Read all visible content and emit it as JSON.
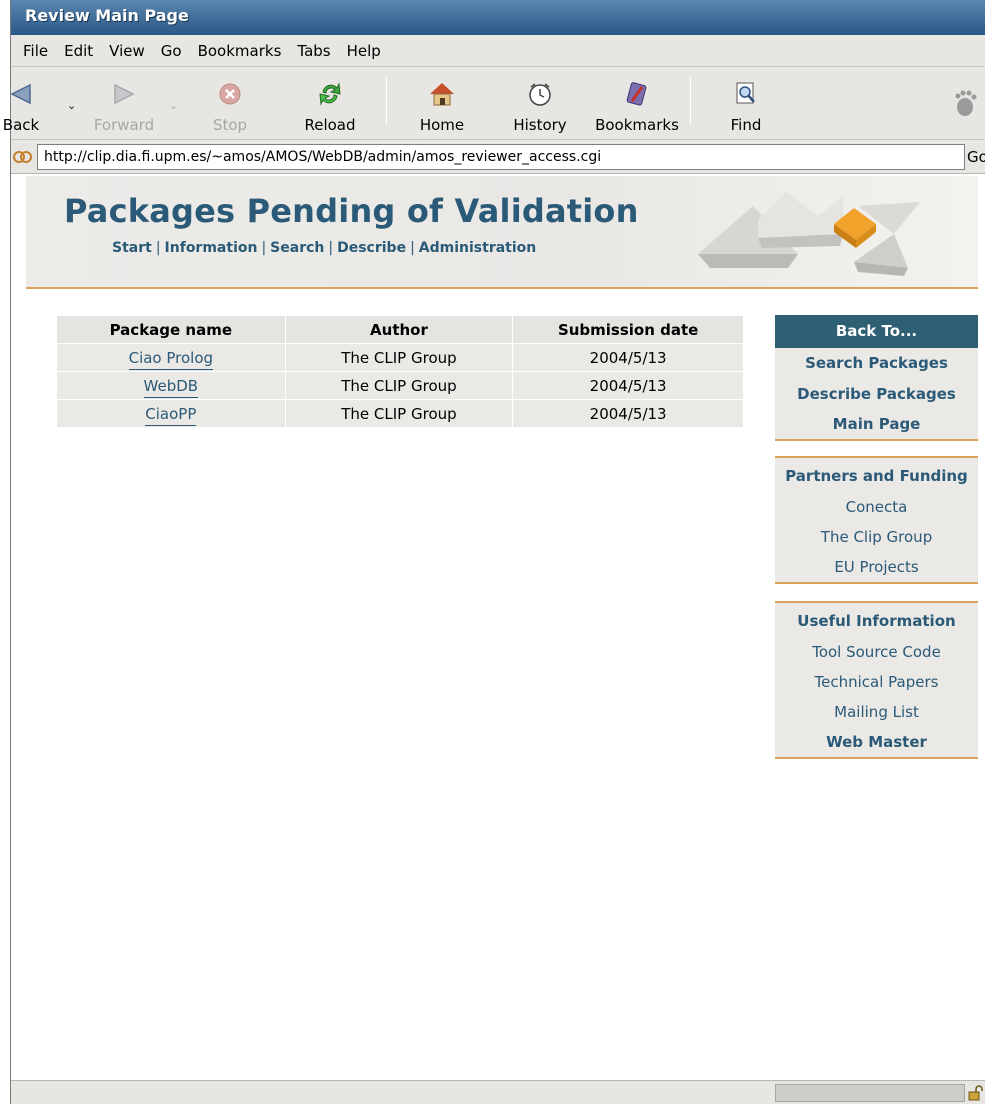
{
  "window": {
    "title": "Review Main Page"
  },
  "menu": [
    {
      "label": "File"
    },
    {
      "label": "Edit"
    },
    {
      "label": "View"
    },
    {
      "label": "Go"
    },
    {
      "label": "Bookmarks"
    },
    {
      "label": "Tabs"
    },
    {
      "label": "Help"
    }
  ],
  "toolbar": {
    "back": "Back",
    "forward": "Forward",
    "stop": "Stop",
    "reload": "Reload",
    "home": "Home",
    "history": "History",
    "bookmarks": "Bookmarks",
    "find": "Find"
  },
  "address": {
    "url": "http://clip.dia.fi.upm.es/~amos/AMOS/WebDB/admin/amos_reviewer_access.cgi",
    "go": "Go"
  },
  "page": {
    "title": "Packages Pending of Validation",
    "nav": [
      "Start",
      "Information",
      "Search",
      "Describe",
      "Administration"
    ]
  },
  "table": {
    "headers": [
      "Package name",
      "Author",
      "Submission date"
    ],
    "rows": [
      {
        "name": "Ciao Prolog",
        "author": "The CLIP Group",
        "date": "2004/5/13"
      },
      {
        "name": "WebDB",
        "author": "The CLIP Group",
        "date": "2004/5/13"
      },
      {
        "name": "CiaoPP",
        "author": "The CLIP Group",
        "date": "2004/5/13"
      }
    ]
  },
  "sidebar": {
    "back_to": {
      "heading": "Back To...",
      "links": [
        "Search Packages",
        "Describe Packages",
        "Main Page"
      ]
    },
    "partners": {
      "heading": "Partners and Funding",
      "links": [
        "Conecta",
        "The Clip Group",
        "EU Projects"
      ]
    },
    "useful": {
      "heading": "Useful Information",
      "links": [
        "Tool Source Code",
        "Technical Papers",
        "Mailing List",
        "Web Master"
      ]
    }
  },
  "colors": {
    "accent": "#2b5a78",
    "rule": "#d9a25a",
    "titlebar": "#2a5886"
  }
}
